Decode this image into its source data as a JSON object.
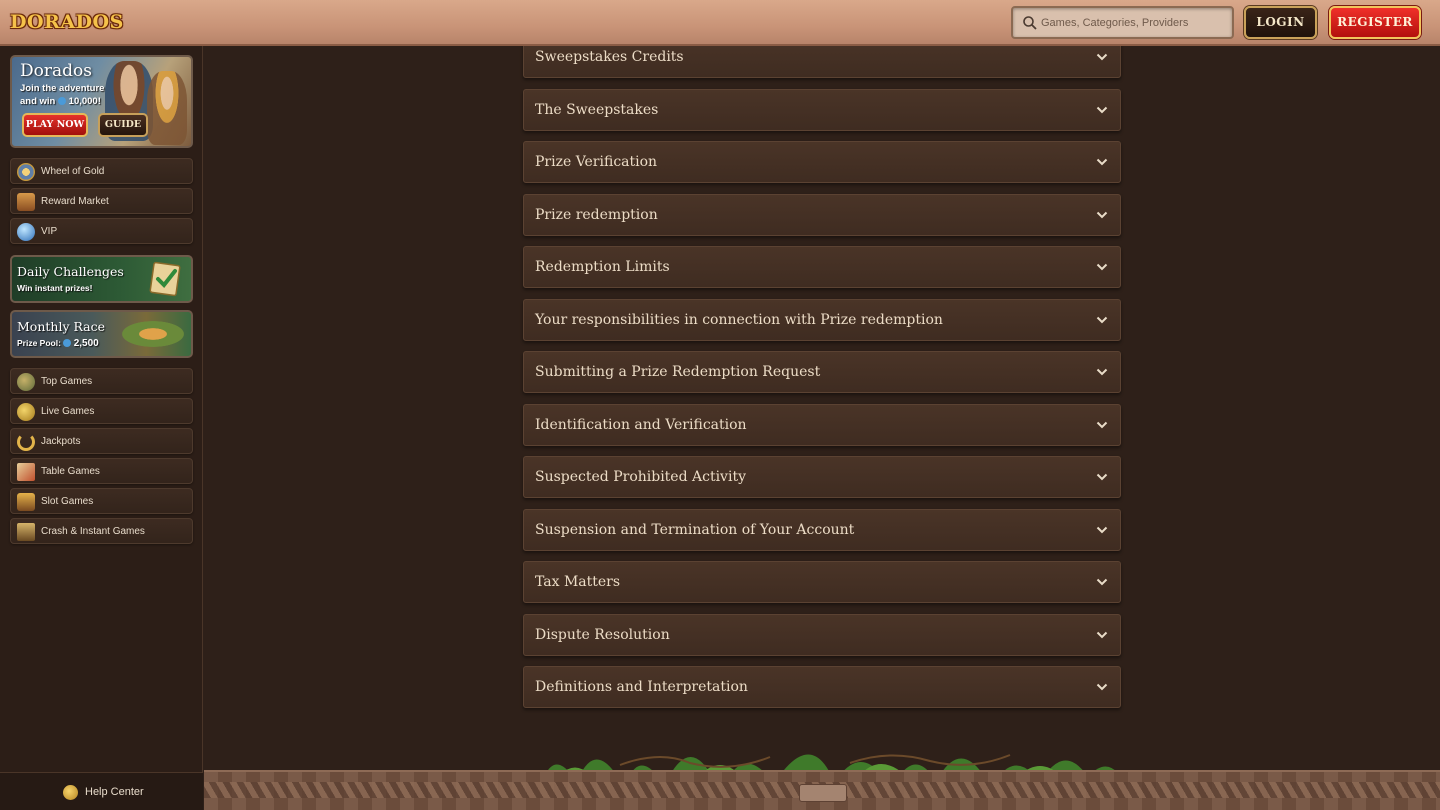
{
  "header": {
    "logo_text": "DORADOS",
    "search_placeholder": "Games, Categories, Providers",
    "login_label": "LOGIN",
    "register_label": "REGISTER"
  },
  "sidebar": {
    "promo": {
      "title": "Dorados",
      "subtitle_line1": "Join the adventure",
      "subtitle_line2": "and win",
      "amount": "10,000!",
      "play_label": "PLAY NOW",
      "guide_label": "GUIDE"
    },
    "top_items": [
      {
        "label": "Wheel of Gold",
        "icon": "wheel-icon"
      },
      {
        "label": "Reward Market",
        "icon": "chest-icon"
      },
      {
        "label": "VIP",
        "icon": "gem-icon"
      }
    ],
    "daily_challenges": {
      "title": "Daily Challenges",
      "subtitle": "Win instant prizes!"
    },
    "monthly_race": {
      "title": "Monthly Race",
      "prize_label": "Prize Pool:",
      "prize_amount": "2,500"
    },
    "game_items": [
      {
        "label": "Top Games",
        "icon": "helmet-icon"
      },
      {
        "label": "Live Games",
        "icon": "coin-icon"
      },
      {
        "label": "Jackpots",
        "icon": "horseshoe-icon"
      },
      {
        "label": "Table Games",
        "icon": "cards-icon"
      },
      {
        "label": "Slot Games",
        "icon": "slot-icon"
      },
      {
        "label": "Crash & Instant Games",
        "icon": "hourglass-icon"
      }
    ],
    "help_label": "Help Center"
  },
  "accordion": [
    "Sweepstakes Credits",
    "The Sweepstakes",
    "Prize Verification",
    "Prize redemption",
    "Redemption Limits",
    "Your responsibilities in connection with Prize redemption",
    "Submitting a Prize Redemption Request",
    "Identification and Verification",
    "Suspected Prohibited Activity",
    "Suspension and Termination of Your Account",
    "Tax Matters",
    "Dispute Resolution",
    "Definitions and Interpretation"
  ],
  "colors": {
    "background": "#2e2019",
    "accordion_bg": "#4a3427",
    "register": "#d91f1a",
    "gold": "#caa25a"
  }
}
